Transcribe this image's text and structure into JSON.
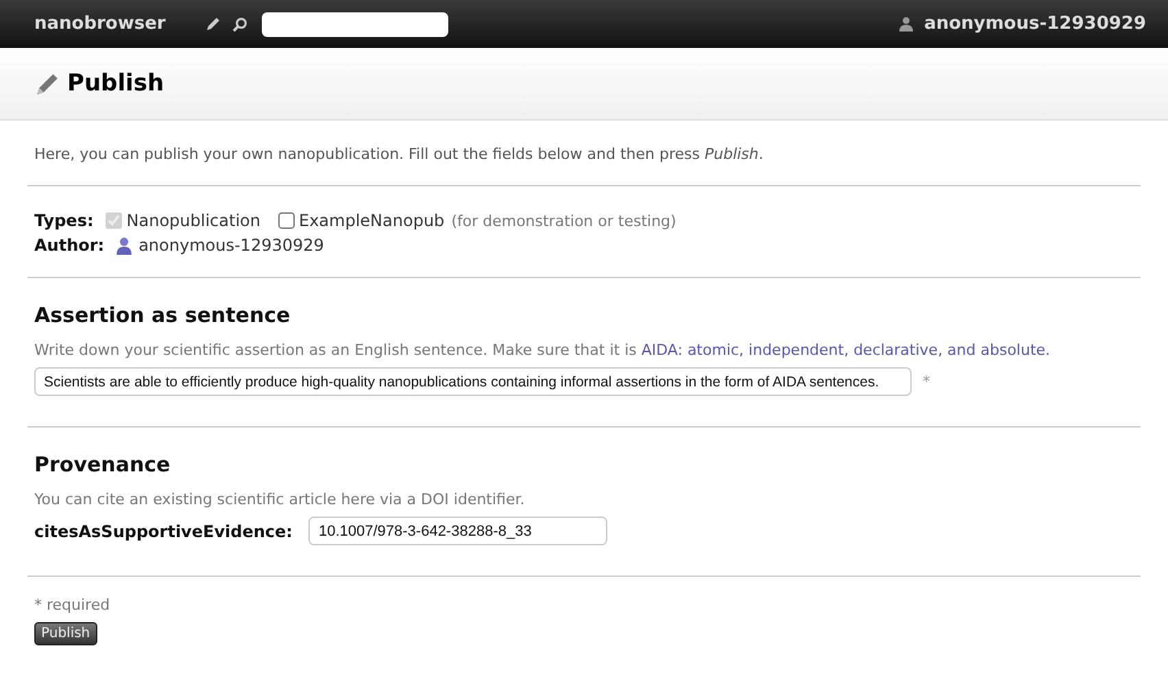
{
  "navbar": {
    "brand": "nanobrowser",
    "user": "anonymous-12930929"
  },
  "page_title": "Publish",
  "intro": "Here, you can publish your own nanopublication. Fill out the fields below and then press *Publish*.",
  "types": {
    "label": "Types:",
    "options": [
      {
        "label": "Nanopublication",
        "checked": true,
        "disabled": true
      },
      {
        "label": "ExampleNanopub",
        "checked": false,
        "disabled": false,
        "note": "(for demonstration or testing)"
      }
    ]
  },
  "author": {
    "label": "Author:",
    "name": "anonymous-12930929"
  },
  "assertion": {
    "heading": "Assertion as sentence",
    "hint": "Write down your scientific assertion as an English sentence. Make sure that it is",
    "link": "AIDA: atomic, independent, declarative, and absolute.",
    "value": "Scientists are able to efficiently produce high-quality nanopublications containing informal assertions in the form of AIDA sentences.",
    "required_mark": "*"
  },
  "provenance": {
    "heading": "Provenance",
    "hint": "You can cite an existing scientific article here via a DOI identifier.",
    "label": "citesAsSupportiveEvidence:",
    "value": "10.1007/978-3-642-38288-8_33"
  },
  "required_note": "* required",
  "submit": "Publish"
}
